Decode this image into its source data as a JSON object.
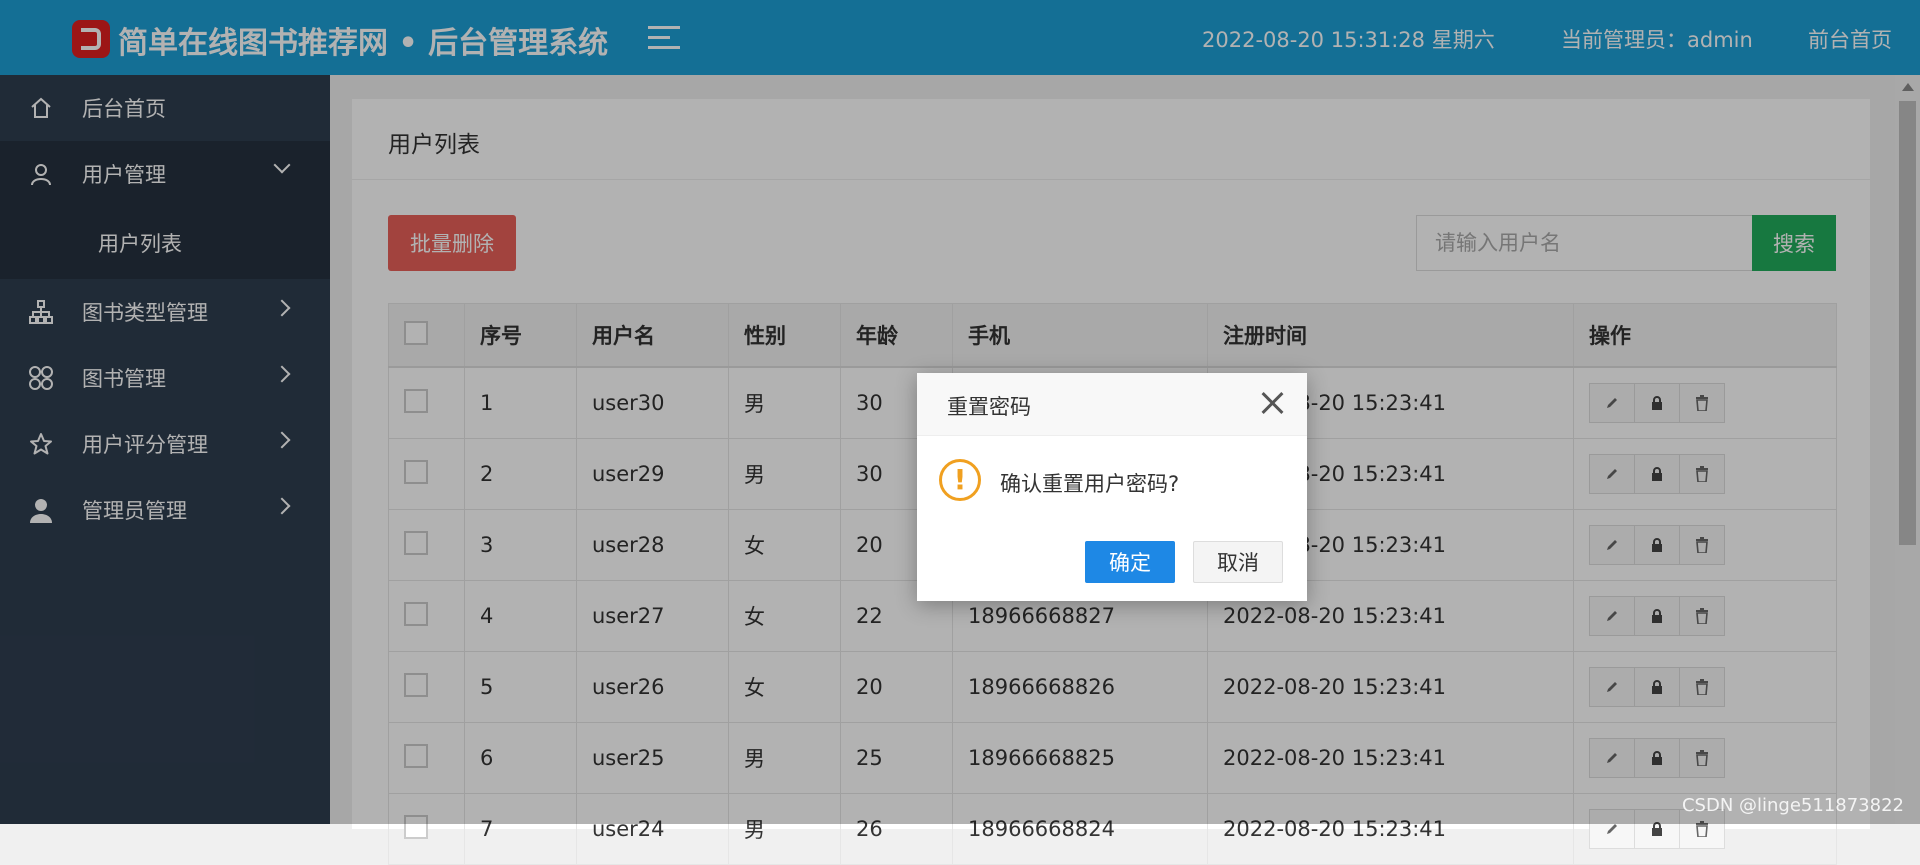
{
  "header": {
    "site_title": "简单在线图书推荐网 • 后台管理系统",
    "datetime": "2022-08-20  15:31:28  星期六",
    "admin_label": "当前管理员：admin",
    "home_link": "前台首页"
  },
  "sidebar": {
    "items": [
      {
        "label": "后台首页",
        "icon": "home-icon"
      },
      {
        "label": "用户管理",
        "icon": "user-icon",
        "expanded": true
      },
      {
        "label": "用户列表"
      },
      {
        "label": "图书类型管理",
        "icon": "sitemap-icon"
      },
      {
        "label": "图书管理",
        "icon": "grid-icon"
      },
      {
        "label": "用户评分管理",
        "icon": "star-icon"
      },
      {
        "label": "管理员管理",
        "icon": "admin-icon"
      }
    ]
  },
  "main": {
    "title": "用户列表",
    "batch_delete": "批量删除",
    "search_placeholder": "请输入用户名",
    "search_button": "搜索",
    "columns": [
      "序号",
      "用户名",
      "性别",
      "年龄",
      "手机",
      "注册时间",
      "操作"
    ],
    "rows": [
      {
        "no": "1",
        "username": "user30",
        "gender": "男",
        "age": "30",
        "phone": "",
        "registered": "2022-08-20 15:23:41"
      },
      {
        "no": "2",
        "username": "user29",
        "gender": "男",
        "age": "30",
        "phone": "",
        "registered": "2022-08-20 15:23:41"
      },
      {
        "no": "3",
        "username": "user28",
        "gender": "女",
        "age": "20",
        "phone": "",
        "registered": "2022-08-20 15:23:41"
      },
      {
        "no": "4",
        "username": "user27",
        "gender": "女",
        "age": "22",
        "phone": "18966668827",
        "registered": "2022-08-20 15:23:41"
      },
      {
        "no": "5",
        "username": "user26",
        "gender": "女",
        "age": "20",
        "phone": "18966668826",
        "registered": "2022-08-20 15:23:41"
      },
      {
        "no": "6",
        "username": "user25",
        "gender": "男",
        "age": "25",
        "phone": "18966668825",
        "registered": "2022-08-20 15:23:41"
      },
      {
        "no": "7",
        "username": "user24",
        "gender": "男",
        "age": "26",
        "phone": "18966668824",
        "registered": "2022-08-20 15:23:41"
      }
    ]
  },
  "dialog": {
    "title": "重置密码",
    "message": "确认重置用户密码?",
    "ok": "确定",
    "cancel": "取消"
  },
  "watermark": "CSDN @linge511873822",
  "colors": {
    "header": "#1e9fd6",
    "sidebar": "#2f3e50",
    "danger": "#e9605a",
    "success": "#22ad5c",
    "primary": "#1e88e5",
    "warning": "#f0a020"
  }
}
